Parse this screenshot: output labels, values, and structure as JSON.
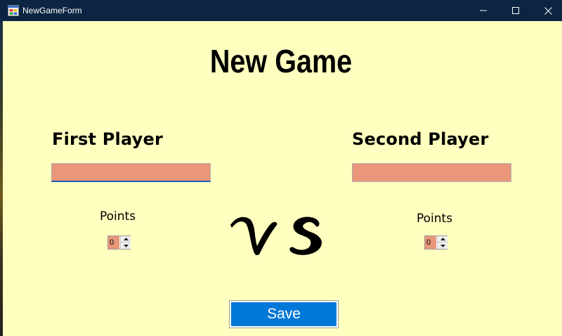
{
  "window": {
    "title": "NewGameForm",
    "controls": {
      "minimize_icon": "minimize-icon",
      "maximize_icon": "maximize-icon",
      "close_icon": "close-icon"
    }
  },
  "form": {
    "heading": "New Game",
    "vs_text": "VS",
    "first_player": {
      "label": "First Player",
      "name_value": "",
      "points_label": "Points",
      "points_value": "0"
    },
    "second_player": {
      "label": "Second Player",
      "name_value": "",
      "points_label": "Points",
      "points_value": "0"
    },
    "save_label": "Save"
  },
  "colors": {
    "background": "#ffffc0",
    "titlebar": "#0b2542",
    "input_fill": "#e9967a",
    "save_button": "#0078d7"
  }
}
